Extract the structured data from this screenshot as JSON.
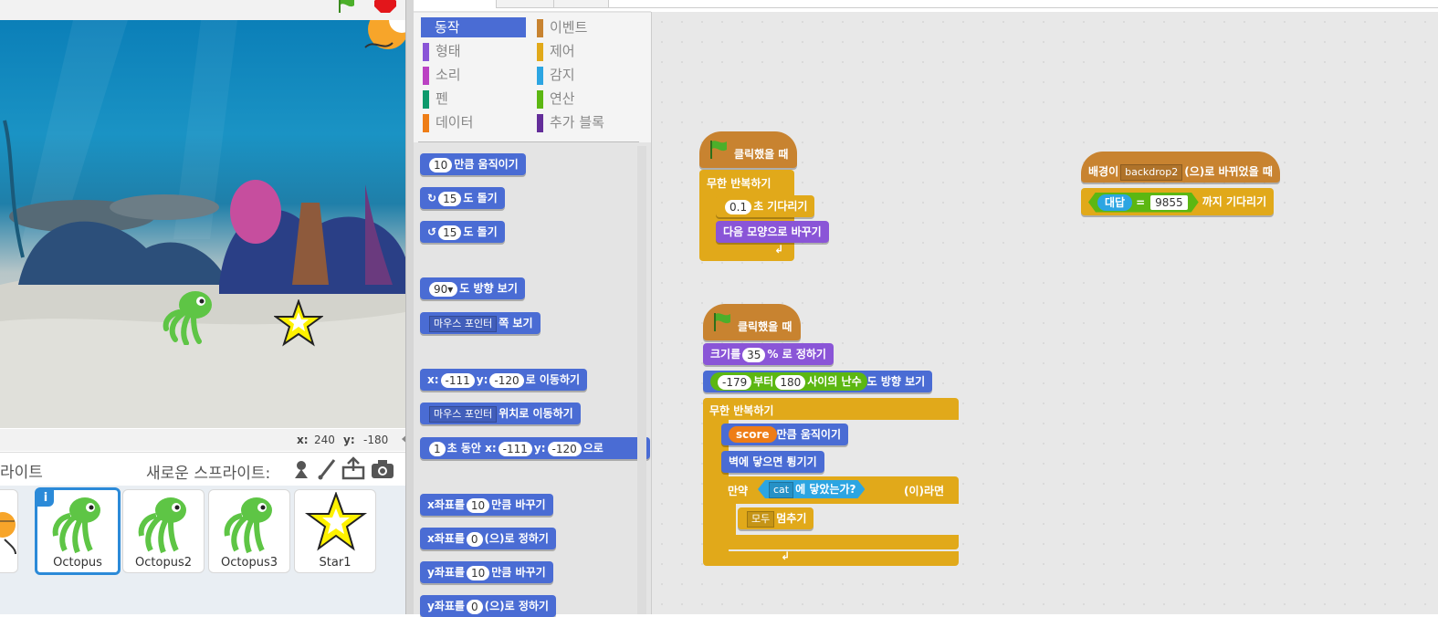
{
  "stage": {
    "coord_x_label": "x:",
    "coord_x": "240",
    "coord_y_label": "y:",
    "coord_y": "-180"
  },
  "sprites": {
    "section_label": "라이트",
    "new_sprite_label": "새로운 스프라이트:",
    "items": [
      {
        "name": "Octopus"
      },
      {
        "name": "Octopus2"
      },
      {
        "name": "Octopus3"
      },
      {
        "name": "Star1"
      }
    ]
  },
  "categories": {
    "left": [
      "동작",
      "형태",
      "소리",
      "펜",
      "데이터"
    ],
    "right": [
      "이벤트",
      "제어",
      "감지",
      "연산",
      "추가 블록"
    ],
    "colors": {
      "동작": "#4a6cd4",
      "형태": "#8a55d7",
      "소리": "#bb42c3",
      "펜": "#0e9a6c",
      "데이터": "#ee7d16",
      "이벤트": "#c88330",
      "제어": "#e1a91a",
      "감지": "#2ca5e2",
      "연산": "#5cb712",
      "추가 블록": "#632d99"
    }
  },
  "palette": {
    "move": {
      "steps": "10",
      "text": "만큼 움직이기"
    },
    "turn_right": {
      "deg": "15",
      "text": "도 돌기"
    },
    "turn_left": {
      "deg": "15",
      "text": "도 돌기"
    },
    "point_dir": {
      "deg": "90▾",
      "text": "도 방향 보기"
    },
    "point_towards": {
      "target": "마우스 포인터",
      "text": "쪽 보기"
    },
    "goto_xy": {
      "x_label": "x:",
      "x": "-111",
      "y_label": "y:",
      "y": "-120",
      "text": "로 이동하기"
    },
    "goto_target": {
      "target": "마우스 포인터",
      "text": "위치로 이동하기"
    },
    "glide": {
      "secs": "1",
      "pre": "초 동안 x:",
      "x": "-111",
      "y_label": "y:",
      "y": "-120",
      "text": "으로"
    },
    "change_x": {
      "pre": "x좌표를",
      "val": "10",
      "text": "만큼 바꾸기"
    },
    "set_x": {
      "pre": "x좌표를",
      "val": "0",
      "text": "(으)로 정하기"
    },
    "change_y": {
      "pre": "y좌표를",
      "val": "10",
      "text": "만큼 바꾸기"
    },
    "set_y": {
      "pre": "y좌표를",
      "val": "0",
      "text": "(으)로 정하기"
    }
  },
  "scripts": {
    "s1": {
      "hat": "클릭했을 때",
      "forever": "무한 반복하기",
      "wait_val": "0.1",
      "wait_text": "초 기다리기",
      "next_costume": "다음 모양으로 바꾸기"
    },
    "s2": {
      "hat": "클릭했을 때",
      "size_pre": "크기를",
      "size_val": "35",
      "size_text": "% 로 정하기",
      "rand_from": "-179",
      "rand_mid": "부터",
      "rand_to": "180",
      "rand_text": "사이의 난수",
      "dir_text": "도 방향 보기",
      "forever": "무한 반복하기",
      "move_var": "score",
      "move_text": "만큼 움직이기",
      "bounce": "벽에 닿으면 튕기기",
      "if_pre": "만약",
      "touch_target": "cat",
      "touch_text": "에 닿았는가?",
      "if_post": "(이)라면",
      "stop_opt": "모두",
      "stop_text": "멈추기"
    },
    "s3": {
      "hat_pre": "배경이",
      "backdrop": "backdrop2",
      "hat_post": "(으)로 바뀌었을 때",
      "var": "대답",
      "eq": "=",
      "eq_val": "9855",
      "wait_text": "까지 기다리기"
    }
  }
}
